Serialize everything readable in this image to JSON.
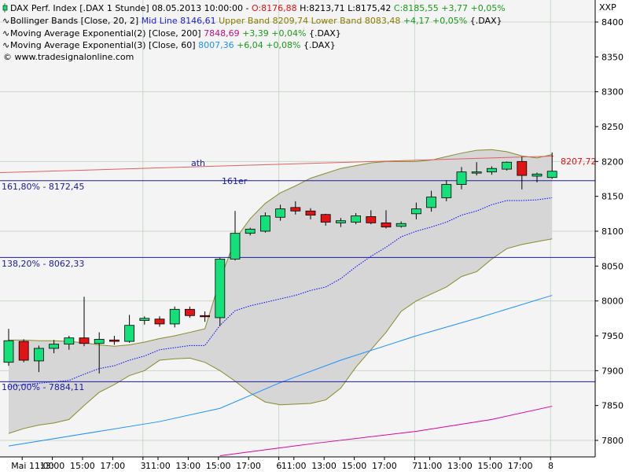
{
  "colors": {
    "background": "#ffffff",
    "plot_background": "#f4f4f4",
    "grid": "#c8d8c8",
    "band_fill": "#d6d6d6",
    "band_line": "#8a8a2a",
    "mid_line": "#0000ff",
    "ema200": "#e000a0",
    "ema60": "#1e90ff",
    "candle_up": "#14e07a",
    "candle_down": "#e01414",
    "fib_line": "#1a1aa0",
    "ath_line": "#e06060",
    "ath_label": "#1a1aa0",
    "price_value": "#e01414",
    "green_value": "#1a9a1a",
    "blue_value": "#1e90ff",
    "magenta_value": "#c01080",
    "olive_value": "#8a7a00"
  },
  "header": {
    "line1": {
      "prefix": "DAX Perf. Index [.DAX  1 Stunde] 08.05.2013 10:00:00 - ",
      "open": "O:8176,88",
      "rest": " H:8213,71 L:8175,42 ",
      "close": "C:8185,55 +3,77 +0,05%"
    },
    "line2": {
      "prefix": "Bollinger Bands [Close, 20, 2] ",
      "mid": "Mid Line 8146,61",
      "upper": " Upper Band 8209,74 Lower Band 8083,48",
      "change": " +4,17 +0,05%",
      "suffix": " {.DAX}"
    },
    "line3": {
      "prefix": "Moving Average Exponential(2) [Close, 200] ",
      "value": "7848,69",
      "change": " +3,39 +0,04%",
      "suffix": " {.DAX}"
    },
    "line4": {
      "prefix": "Moving Average Exponential(3) [Close, 60] ",
      "value": "8007,36",
      "change": " +6,04 +0,08%",
      "suffix": " {.DAX}"
    },
    "line5": "© www.tradesignalonline.com"
  },
  "y_axis_symbol": "XXP",
  "annotations": {
    "ath": "ath",
    "level_161er": "161er",
    "fib_161": "161,80% - 8172,45",
    "fib_138": "138,20% - 8062,33",
    "fib_100": "100,00% - 7884,11",
    "last_price": "8207,72"
  },
  "chart_data": {
    "type": "candlestick",
    "title": "DAX Perf. Index [.DAX  1 Stunde] 08.05.2013 10:00:00",
    "ylim": [
      7775,
      8430
    ],
    "y_ticks": [
      7800,
      7850,
      7900,
      7950,
      8000,
      8050,
      8100,
      8150,
      8200,
      8250,
      8300,
      8350,
      8400
    ],
    "y_tick_labels": [
      "7800",
      "7850",
      "7900",
      "7950",
      "8000",
      "8050",
      "8100",
      "8150",
      "8200",
      "8250",
      "8300",
      "8350",
      "8400"
    ],
    "x_tick_labels": [
      {
        "i": 1,
        "label": "Mai 11:00"
      },
      {
        "i": 3,
        "label": "13:00"
      },
      {
        "i": 5,
        "label": "15:00"
      },
      {
        "i": 7,
        "label": "17:00"
      },
      {
        "i": 9,
        "label": "3"
      },
      {
        "i": 10,
        "label": "11:00"
      },
      {
        "i": 12,
        "label": "13:00"
      },
      {
        "i": 14,
        "label": "15:00"
      },
      {
        "i": 16,
        "label": "17:00"
      },
      {
        "i": 18,
        "label": "6"
      },
      {
        "i": 19,
        "label": "11:00"
      },
      {
        "i": 21,
        "label": "13:00"
      },
      {
        "i": 23,
        "label": "15:00"
      },
      {
        "i": 25,
        "label": "17:00"
      },
      {
        "i": 27,
        "label": "7"
      },
      {
        "i": 28,
        "label": "11:00"
      },
      {
        "i": 30,
        "label": "13:00"
      },
      {
        "i": 32,
        "label": "15:00"
      },
      {
        "i": 34,
        "label": "17:00"
      },
      {
        "i": 36,
        "label": "8"
      }
    ],
    "day_separators": [
      9,
      18,
      27,
      36
    ],
    "candles": [
      {
        "o": 7912,
        "h": 7960,
        "l": 7907,
        "c": 7943
      },
      {
        "o": 7942,
        "h": 7945,
        "l": 7912,
        "c": 7915
      },
      {
        "o": 7914,
        "h": 7936,
        "l": 7898,
        "c": 7932
      },
      {
        "o": 7932,
        "h": 7944,
        "l": 7925,
        "c": 7938
      },
      {
        "o": 7938,
        "h": 7950,
        "l": 7930,
        "c": 7947
      },
      {
        "o": 7947,
        "h": 8006,
        "l": 7935,
        "c": 7939
      },
      {
        "o": 7939,
        "h": 7955,
        "l": 7896,
        "c": 7945
      },
      {
        "o": 7944,
        "h": 7950,
        "l": 7937,
        "c": 7942
      },
      {
        "o": 7942,
        "h": 7980,
        "l": 7940,
        "c": 7965
      },
      {
        "o": 7972,
        "h": 7978,
        "l": 7966,
        "c": 7975
      },
      {
        "o": 7974,
        "h": 7978,
        "l": 7963,
        "c": 7967
      },
      {
        "o": 7967,
        "h": 7992,
        "l": 7962,
        "c": 7988
      },
      {
        "o": 7988,
        "h": 7992,
        "l": 7976,
        "c": 7979
      },
      {
        "o": 7979,
        "h": 7985,
        "l": 7970,
        "c": 7978
      },
      {
        "o": 7976,
        "h": 8062,
        "l": 7964,
        "c": 8060
      },
      {
        "o": 8060,
        "h": 8129,
        "l": 8058,
        "c": 8097
      },
      {
        "o": 8097,
        "h": 8105,
        "l": 8094,
        "c": 8103
      },
      {
        "o": 8100,
        "h": 8127,
        "l": 8098,
        "c": 8122
      },
      {
        "o": 8120,
        "h": 8138,
        "l": 8115,
        "c": 8132
      },
      {
        "o": 8134,
        "h": 8143,
        "l": 8124,
        "c": 8129
      },
      {
        "o": 8129,
        "h": 8133,
        "l": 8117,
        "c": 8123
      },
      {
        "o": 8124,
        "h": 8125,
        "l": 8108,
        "c": 8113
      },
      {
        "o": 8112,
        "h": 8119,
        "l": 8106,
        "c": 8115
      },
      {
        "o": 8113,
        "h": 8126,
        "l": 8110,
        "c": 8122
      },
      {
        "o": 8121,
        "h": 8130,
        "l": 8110,
        "c": 8112
      },
      {
        "o": 8112,
        "h": 8130,
        "l": 8104,
        "c": 8106
      },
      {
        "o": 8107,
        "h": 8114,
        "l": 8105,
        "c": 8111
      },
      {
        "o": 8125,
        "h": 8141,
        "l": 8117,
        "c": 8132
      },
      {
        "o": 8134,
        "h": 8158,
        "l": 8128,
        "c": 8149
      },
      {
        "o": 8148,
        "h": 8173,
        "l": 8143,
        "c": 8167
      },
      {
        "o": 8167,
        "h": 8192,
        "l": 8160,
        "c": 8185
      },
      {
        "o": 8184,
        "h": 8199,
        "l": 8180,
        "c": 8185
      },
      {
        "o": 8185,
        "h": 8193,
        "l": 8181,
        "c": 8190
      },
      {
        "o": 8189,
        "h": 8200,
        "l": 8187,
        "c": 8199
      },
      {
        "o": 8200,
        "h": 8207,
        "l": 8160,
        "c": 8180
      },
      {
        "o": 8179,
        "h": 8184,
        "l": 8170,
        "c": 8182
      },
      {
        "o": 8177,
        "h": 8213,
        "l": 8175,
        "c": 8186
      }
    ],
    "bollinger": {
      "upper": [
        7944,
        7944,
        7943,
        7943,
        7942,
        7940,
        7937,
        7935,
        7937,
        7941,
        7946,
        7950,
        7955,
        7960,
        8030,
        8088,
        8118,
        8140,
        8155,
        8165,
        8176,
        8183,
        8190,
        8194,
        8198,
        8200,
        8200,
        8200,
        8202,
        8207,
        8212,
        8216,
        8217,
        8214,
        8208,
        8205,
        8210
      ],
      "lower": [
        7810,
        7817,
        7822,
        7825,
        7830,
        7850,
        7869,
        7880,
        7893,
        7900,
        7915,
        7917,
        7918,
        7912,
        7900,
        7885,
        7868,
        7855,
        7851,
        7852,
        7853,
        7858,
        7875,
        7905,
        7930,
        7955,
        7985,
        8000,
        8010,
        8020,
        8035,
        8042,
        8060,
        8075,
        8081,
        8085,
        8089
      ],
      "mid": [
        7877,
        7880,
        7882,
        7884,
        7886,
        7895,
        7903,
        7907,
        7915,
        7921,
        7930,
        7933,
        7936,
        7936,
        7965,
        7986,
        7993,
        7998,
        8003,
        8008,
        8015,
        8020,
        8032,
        8049,
        8064,
        8077,
        8092,
        8100,
        8106,
        8113,
        8123,
        8129,
        8138,
        8144,
        8144,
        8145,
        8148
      ]
    },
    "ema60": [
      {
        "i": 0,
        "v": 7792
      },
      {
        "i": 10,
        "v": 7827
      },
      {
        "i": 14,
        "v": 7846
      },
      {
        "i": 18,
        "v": 7883
      },
      {
        "i": 22,
        "v": 7915
      },
      {
        "i": 27,
        "v": 7950
      },
      {
        "i": 31,
        "v": 7975
      },
      {
        "i": 36,
        "v": 8008
      }
    ],
    "ema200": [
      {
        "i": 14,
        "v": 7778
      },
      {
        "i": 20,
        "v": 7795
      },
      {
        "i": 27,
        "v": 7813
      },
      {
        "i": 32,
        "v": 7830
      },
      {
        "i": 36,
        "v": 7849
      }
    ],
    "levels": {
      "fib_161": 8172.45,
      "fib_138": 8062.33,
      "fib_100": 7884.11,
      "ath_start": 8184,
      "ath_end": 8207.72
    }
  }
}
